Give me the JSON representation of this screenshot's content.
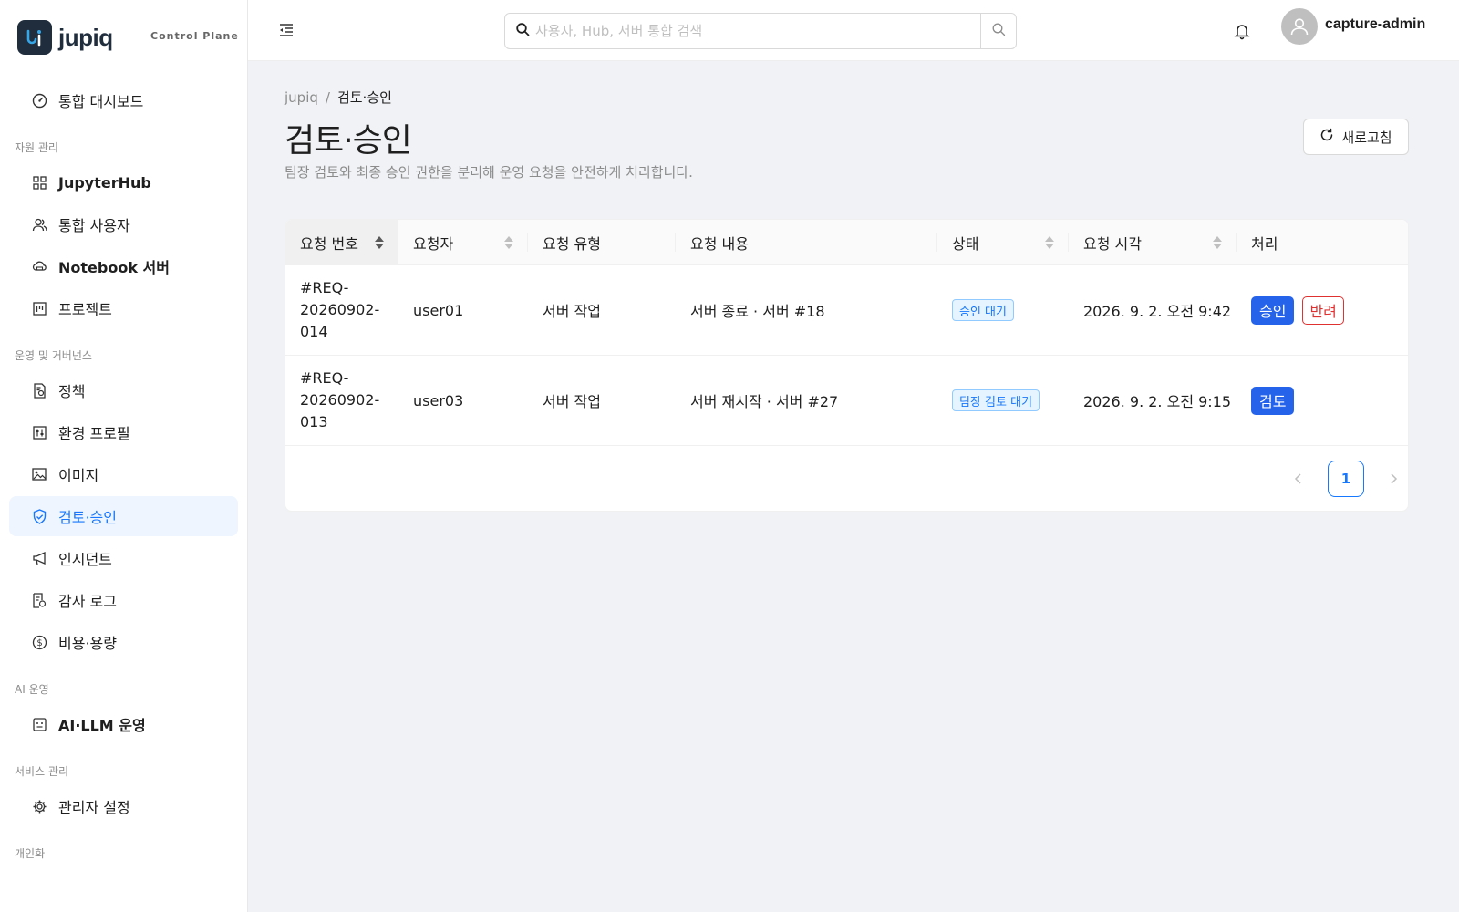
{
  "brand": {
    "name": "jupiq",
    "subtitle": "Control Plane"
  },
  "sidebar": {
    "top_item": {
      "label": "통합 대시보드",
      "icon": "dashboard-icon"
    },
    "sections": [
      {
        "label": "자원 관리",
        "items": [
          {
            "label": "JupyterHub",
            "icon": "grid-icon"
          },
          {
            "label": "통합 사용자",
            "icon": "users-icon"
          },
          {
            "label": "Notebook 서버",
            "icon": "cloud-server-icon"
          },
          {
            "label": "프로젝트",
            "icon": "project-icon"
          }
        ]
      },
      {
        "label": "운영 및 거버넌스",
        "items": [
          {
            "label": "정책",
            "icon": "policy-icon"
          },
          {
            "label": "환경 프로필",
            "icon": "sliders-icon"
          },
          {
            "label": "이미지",
            "icon": "image-icon"
          },
          {
            "label": "검토·승인",
            "icon": "shield-check-icon",
            "active": true
          },
          {
            "label": "인시던트",
            "icon": "megaphone-icon"
          },
          {
            "label": "감사 로그",
            "icon": "audit-icon"
          },
          {
            "label": "비용·용량",
            "icon": "dollar-icon"
          }
        ]
      },
      {
        "label": "AI 운영",
        "items": [
          {
            "label": "AI·LLM 운영",
            "icon": "robot-icon"
          }
        ]
      },
      {
        "label": "서비스 관리",
        "items": [
          {
            "label": "관리자 설정",
            "icon": "gear-icon"
          }
        ]
      },
      {
        "label": "개인화",
        "items": []
      }
    ]
  },
  "header": {
    "search_placeholder": "사용자, Hub, 서버 통합 검색",
    "user_name": "capture-admin"
  },
  "breadcrumb": {
    "root": "jupiq",
    "separator": "/",
    "current": "검토·승인"
  },
  "page": {
    "title": "검토·승인",
    "description": "팀장 검토와 최종 승인 권한을 분리해 운영 요청을 안전하게 처리합니다.",
    "refresh_label": "새로고침"
  },
  "table": {
    "columns": [
      {
        "label": "요청 번호",
        "sortable": true,
        "sorted": true
      },
      {
        "label": "요청자",
        "sortable": true
      },
      {
        "label": "요청 유형",
        "sortable": false
      },
      {
        "label": "요청 내용",
        "sortable": false
      },
      {
        "label": "상태",
        "sortable": true
      },
      {
        "label": "요청 시각",
        "sortable": true
      },
      {
        "label": "처리",
        "sortable": false
      }
    ],
    "rows": [
      {
        "id": "#REQ-20260902-014",
        "requester": "user01",
        "type": "서버 작업",
        "content": "서버 종료 · 서버 #18",
        "status": "승인 대기",
        "time": "2026. 9. 2. 오전 9:42",
        "actions": [
          "승인",
          "반려"
        ]
      },
      {
        "id": "#REQ-20260902-013",
        "requester": "user03",
        "type": "서버 작업",
        "content": "서버 재시작 · 서버 #27",
        "status": "팀장 검토 대기",
        "time": "2026. 9. 2. 오전 9:15",
        "actions": [
          "검토"
        ]
      }
    ]
  },
  "pagination": {
    "current_page": "1"
  },
  "colors": {
    "accent": "#1677ff",
    "primary_button": "#2563eb",
    "danger": "#e03131",
    "brand_bg": "#1f2d3d"
  }
}
